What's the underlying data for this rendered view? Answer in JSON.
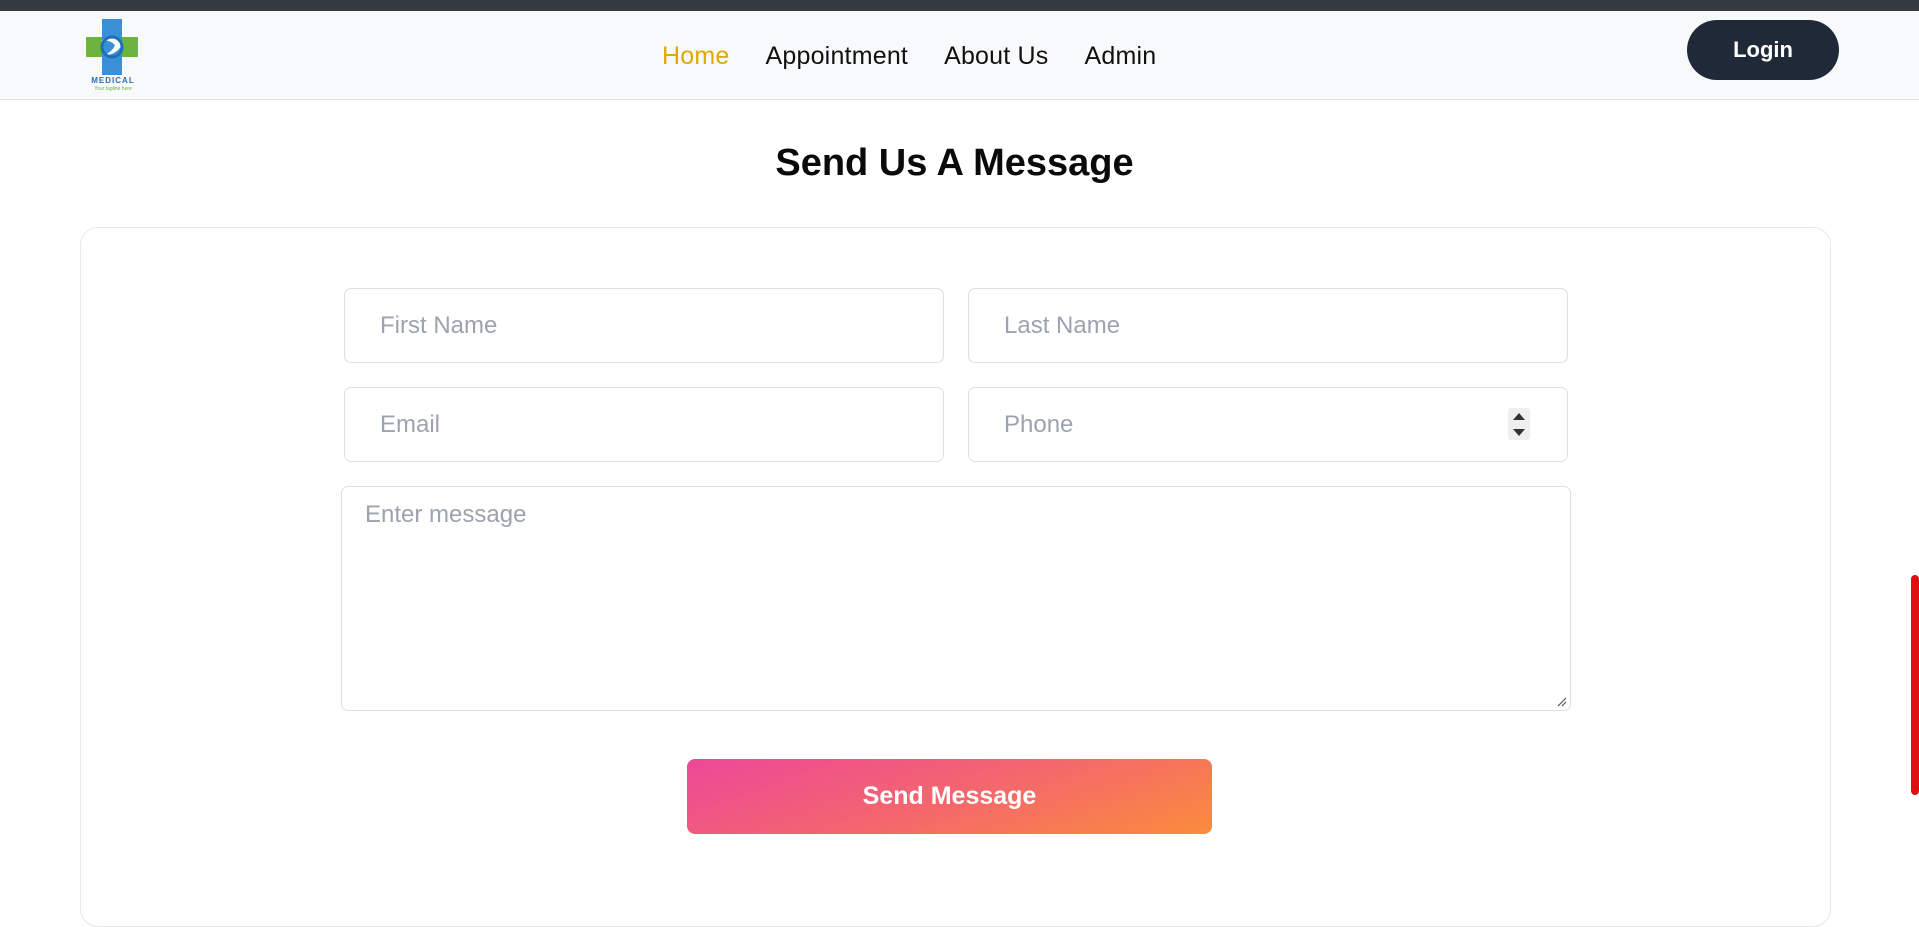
{
  "brand": {
    "logo_icon": "medical-cross-logo-icon",
    "logo_text": "MEDICAL",
    "logo_tagline": "Your tagline here"
  },
  "nav": {
    "items": [
      {
        "label": "Home",
        "active": true
      },
      {
        "label": "Appointment",
        "active": false
      },
      {
        "label": "About Us",
        "active": false
      },
      {
        "label": "Admin",
        "active": false
      }
    ],
    "login_label": "Login"
  },
  "form": {
    "title": "Send Us A Message",
    "first_name_placeholder": "First Name",
    "last_name_placeholder": "Last Name",
    "email_placeholder": "Email",
    "phone_placeholder": "Phone",
    "message_placeholder": "Enter message",
    "submit_label": "Send Message"
  },
  "colors": {
    "nav_active": "#e0a800",
    "login_bg": "#1f2937",
    "button_gradient_start": "#ec4899",
    "button_gradient_end": "#fb8c3c",
    "scrollbar": "#e01010"
  }
}
